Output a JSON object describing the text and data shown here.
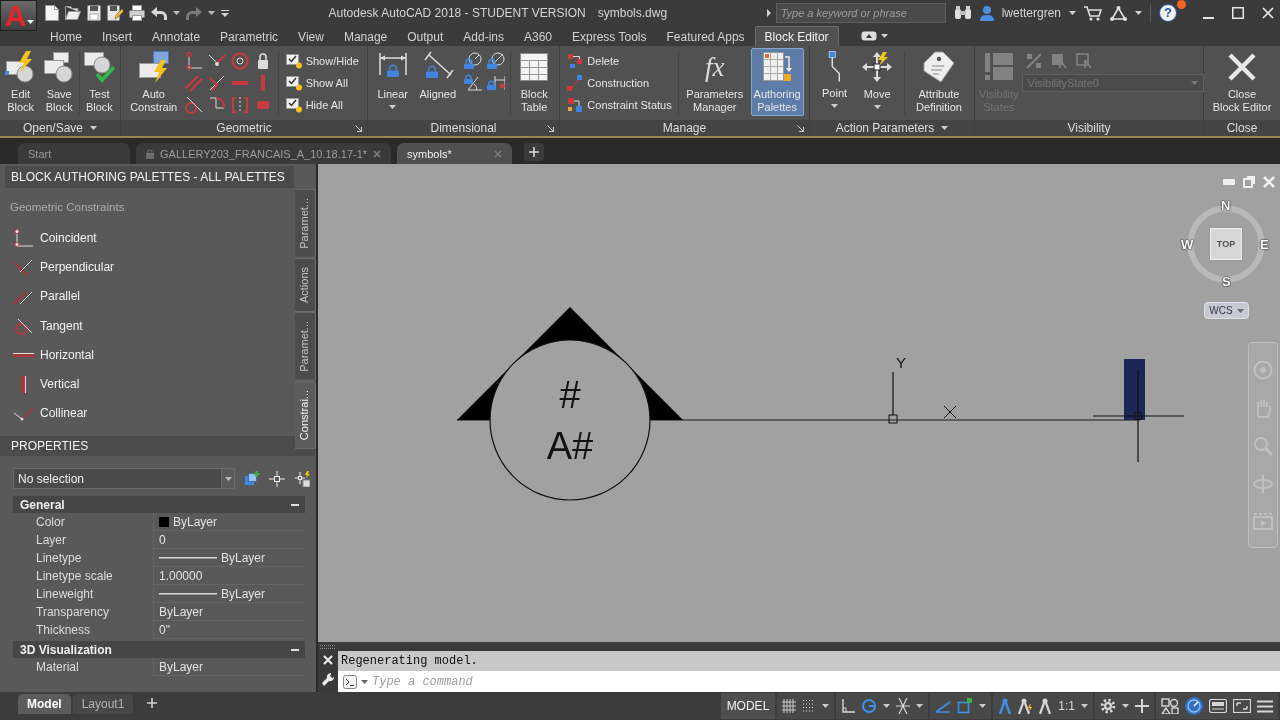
{
  "title_bar": {
    "app_button": "A",
    "title": "Autodesk AutoCAD 2018 - STUDENT VERSION",
    "document": "symbols.dwg",
    "search": {
      "placeholder": "Type a keyword or phrase"
    },
    "user": "lwettergren",
    "help": "?"
  },
  "ribbon": {
    "tabs": [
      {
        "label": "Home",
        "selected": false
      },
      {
        "label": "Insert",
        "selected": false
      },
      {
        "label": "Annotate",
        "selected": false
      },
      {
        "label": "Parametric",
        "selected": false
      },
      {
        "label": "View",
        "selected": false
      },
      {
        "label": "Manage",
        "selected": false
      },
      {
        "label": "Output",
        "selected": false
      },
      {
        "label": "Add-ins",
        "selected": false
      },
      {
        "label": "A360",
        "selected": false
      },
      {
        "label": "Express Tools",
        "selected": false
      },
      {
        "label": "Featured Apps",
        "selected": false
      },
      {
        "label": "Block Editor",
        "selected": true
      }
    ],
    "panels": [
      {
        "title": "Open/Save",
        "menu": true,
        "launcher": false,
        "disabled": false,
        "tools": [
          {
            "kind": "large",
            "label": "Edit\nBlock"
          },
          {
            "kind": "large",
            "label": "Save\nBlock"
          },
          {
            "kind": "large",
            "label": "Test\nBlock"
          }
        ]
      },
      {
        "title": "Geometric",
        "menu": false,
        "launcher": true,
        "disabled": false,
        "tools": [
          {
            "kind": "large",
            "label": "Auto\nConstrain"
          },
          {
            "kind": "small",
            "label": "Show/Hide"
          },
          {
            "kind": "small",
            "label": "Show All"
          },
          {
            "kind": "small",
            "label": "Hide All"
          }
        ]
      },
      {
        "title": "Dimensional",
        "menu": false,
        "launcher": true,
        "disabled": false,
        "tools": [
          {
            "kind": "split",
            "label": "Linear"
          },
          {
            "kind": "large",
            "label": "Aligned"
          },
          {
            "kind": "large",
            "label": "Block\nTable"
          }
        ]
      },
      {
        "title": "Manage",
        "menu": false,
        "launcher": true,
        "disabled": false,
        "tools": [
          {
            "kind": "small",
            "label": "Delete",
            "on": false
          },
          {
            "kind": "small",
            "label": "Construction",
            "on": false
          },
          {
            "kind": "small",
            "label": "Constraint Status",
            "on": false
          },
          {
            "kind": "large",
            "label": "Parameters\nManager",
            "glyph": "fx",
            "on": false
          },
          {
            "kind": "large",
            "label": "Authoring\nPalettes",
            "on": true
          }
        ]
      },
      {
        "title": "Action Parameters",
        "menu": true,
        "launcher": false,
        "disabled": false,
        "tools": [
          {
            "kind": "split",
            "label": "Point"
          },
          {
            "kind": "split",
            "label": "Move"
          },
          {
            "kind": "large",
            "label": "Attribute\nDefinition"
          }
        ]
      },
      {
        "title": "Visibility",
        "menu": false,
        "launcher": false,
        "disabled": true,
        "tools": [
          {
            "kind": "large",
            "label": "Visibility\nStates"
          },
          {
            "kind": "combo",
            "value": "VisibilityState0"
          }
        ]
      },
      {
        "title": "Close",
        "menu": false,
        "launcher": false,
        "disabled": false,
        "tools": [
          {
            "kind": "large",
            "label": "Close\nBlock Editor"
          }
        ]
      }
    ]
  },
  "file_tabs": [
    {
      "label": "Start",
      "selected": false,
      "locked": false,
      "closable": false
    },
    {
      "label": "GALLERY203_FRANCAIS_A_10.18.17-1*",
      "selected": false,
      "locked": true,
      "closable": true
    },
    {
      "label": "symbols*",
      "selected": true,
      "locked": false,
      "closable": true
    }
  ],
  "palette": {
    "title": "BLOCK AUTHORING PALETTES - ALL PALETTES",
    "section": "Geometric Constraints",
    "items": [
      "Coincident",
      "Perpendicular",
      "Parallel",
      "Tangent",
      "Horizontal",
      "Vertical",
      "Collinear"
    ],
    "tabs": [
      {
        "label": "Paramet...",
        "selected": false
      },
      {
        "label": "Actions",
        "selected": false
      },
      {
        "label": "Paramet...",
        "selected": false
      },
      {
        "label": "Constrai...",
        "selected": true
      }
    ]
  },
  "properties": {
    "title": "PROPERTIES",
    "selection": "No selection",
    "categories": [
      {
        "name": "General",
        "expanded": true,
        "rows": [
          {
            "kind": "swatch",
            "label": "Color",
            "value": "ByLayer",
            "color": "#000000"
          },
          {
            "kind": "text",
            "label": "Layer",
            "value": "0"
          },
          {
            "kind": "line",
            "label": "Linetype",
            "value": "ByLayer"
          },
          {
            "kind": "text",
            "label": "Linetype scale",
            "value": "1.00000"
          },
          {
            "kind": "line",
            "label": "Lineweight",
            "value": "ByLayer"
          },
          {
            "kind": "text",
            "label": "Transparency",
            "value": "ByLayer"
          },
          {
            "kind": "text",
            "label": "Thickness",
            "value": "0\""
          }
        ]
      },
      {
        "name": "3D Visualization",
        "expanded": true,
        "rows": [
          {
            "kind": "text",
            "label": "Material",
            "value": "ByLayer"
          }
        ]
      }
    ]
  },
  "canvas": {
    "block_texts": [
      "#",
      "A#"
    ],
    "axis_label": "Y",
    "viewcube": {
      "face": "TOP",
      "north": "N",
      "south": "S",
      "east": "E",
      "west": "W",
      "coordinate_system": "WCS"
    }
  },
  "command_line": {
    "history": "Regenerating model.",
    "placeholder": "Type a command"
  },
  "layout_tabs": [
    {
      "label": "Model",
      "selected": true
    },
    {
      "label": "Layout1",
      "selected": false
    }
  ],
  "status_bar": {
    "space": "MODEL",
    "annotation_scale": "1:1"
  }
}
